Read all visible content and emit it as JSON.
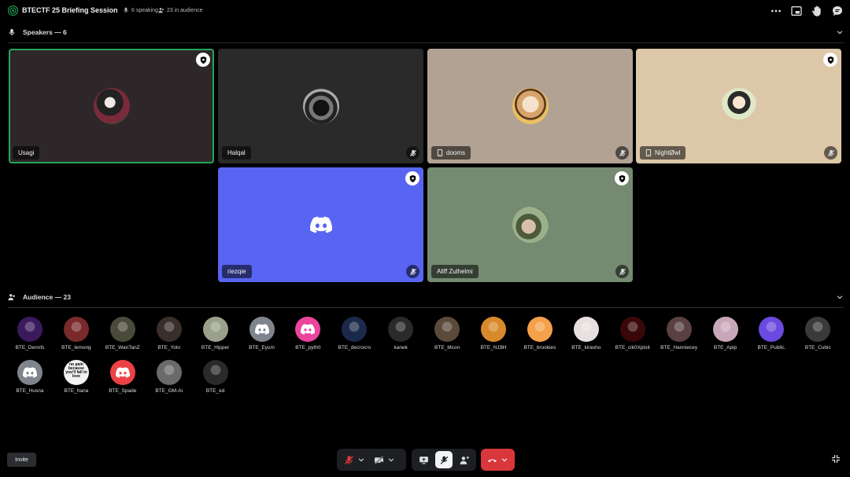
{
  "header": {
    "title": "BTECTF 25 Briefing Session",
    "speaking": "6 speaking",
    "audience": "23 in audience"
  },
  "speakers": {
    "heading": "Speakers — 6",
    "tiles": [
      {
        "name": "Usagi",
        "bg": "#2e2729",
        "speaking": true,
        "badge": true,
        "muted": false,
        "device": false
      },
      {
        "name": "Halqal",
        "bg": "#2a2a2a",
        "speaking": false,
        "badge": false,
        "muted": true,
        "device": false
      },
      {
        "name": "dooms",
        "bg": "#b2a293",
        "speaking": false,
        "badge": false,
        "muted": true,
        "device": true
      },
      {
        "name": "NightØwl",
        "bg": "#ddc7a9",
        "speaking": false,
        "badge": true,
        "muted": true,
        "device": true
      },
      {
        "name": "riezqie",
        "bg": "#5865f2",
        "speaking": false,
        "badge": true,
        "muted": true,
        "device": false
      },
      {
        "name": "Aliff Zulhelmi",
        "bg": "#758a70",
        "speaking": false,
        "badge": true,
        "muted": true,
        "device": false
      }
    ]
  },
  "audience": {
    "heading": "Audience — 23",
    "members": [
      {
        "name": "BTE_Dennfs",
        "color": "#3a1a5c"
      },
      {
        "name": "BTE_lemong",
        "color": "#7a2a2a"
      },
      {
        "name": "BTE_WanTanZ",
        "color": "#4a4a3a"
      },
      {
        "name": "BTE_Yolo",
        "color": "#3a2e2a"
      },
      {
        "name": "BTE_Hipper",
        "color": "#9aa08a"
      },
      {
        "name": "BTE_Eyum",
        "color": "#80848e",
        "discord": true
      },
      {
        "name": "BTE_pyth0",
        "color": "#eb459e",
        "discord": true
      },
      {
        "name": "BTE_decrocro",
        "color": "#1b2a4a"
      },
      {
        "name": "kanek",
        "color": "#2a2a2a"
      },
      {
        "name": "BTE_Mcon",
        "color": "#5a4a3a"
      },
      {
        "name": "BTE_N1$H",
        "color": "#d88a2a"
      },
      {
        "name": "BTE_brookies",
        "color": "#f5a04a"
      },
      {
        "name": "BTE_kirasho",
        "color": "#e8e0e0"
      },
      {
        "name": "BTE_cik0Xploit",
        "color": "#3a0808"
      },
      {
        "name": "BTE_Hanniecey",
        "color": "#5a4040"
      },
      {
        "name": "BTE_Apip",
        "color": "#c8a8b8"
      },
      {
        "name": "BTE_Public.",
        "color": "#6a4ae0"
      },
      {
        "name": "BTE_Cubic",
        "color": "#3a3a3a"
      },
      {
        "name": "BTE_Husna",
        "color": "#80848e",
        "discord": true
      },
      {
        "name": "BTE_hana",
        "color": "#f2f2f2",
        "text_avatar": "no pain because you'll fall in love"
      },
      {
        "name": "BTE_Spade",
        "color": "#ed4245",
        "discord": true
      },
      {
        "name": "BTE_GM-Ai",
        "color": "#6a6a6a"
      },
      {
        "name": "BTE_ed",
        "color": "#2a2a2a"
      }
    ]
  },
  "footer": {
    "invite": "Invite"
  },
  "colors": {
    "accent_green": "#23a55a",
    "danger_red": "#da373c",
    "blurple": "#5865f2"
  }
}
